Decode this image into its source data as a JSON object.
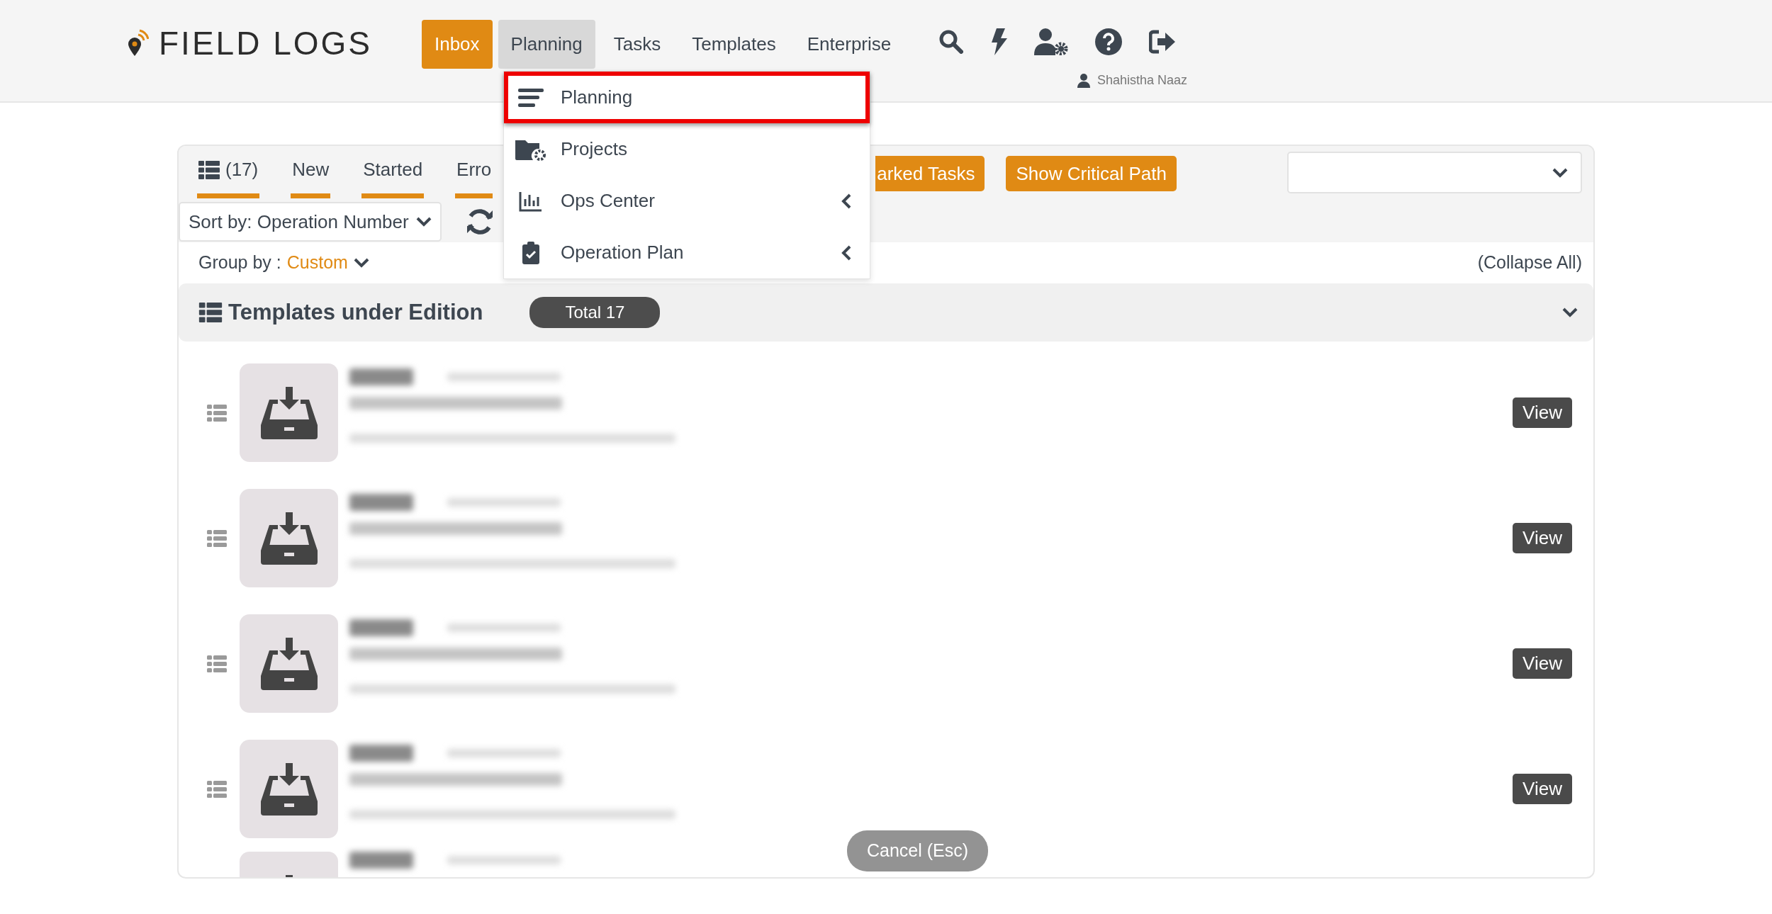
{
  "brand": {
    "name": "FIELD LOGS"
  },
  "nav": [
    {
      "label": "Inbox",
      "kind": "accent",
      "selected": false
    },
    {
      "label": "Planning",
      "kind": "link",
      "selected": true
    },
    {
      "label": "Tasks",
      "kind": "link",
      "selected": false
    },
    {
      "label": "Templates",
      "kind": "link",
      "selected": false
    },
    {
      "label": "Enterprise",
      "kind": "link",
      "selected": false
    }
  ],
  "user": {
    "name": "Shahistha Naaz"
  },
  "dropdown": {
    "items": [
      {
        "label": "Planning",
        "selected": true,
        "has_submenu": false
      },
      {
        "label": "Projects",
        "selected": false,
        "has_submenu": false
      },
      {
        "label": "Ops Center",
        "selected": false,
        "has_submenu": true
      },
      {
        "label": "Operation Plan",
        "selected": false,
        "has_submenu": true
      }
    ]
  },
  "tabs": [
    {
      "label": "(17)",
      "kind": "all"
    },
    {
      "label": "New",
      "kind": "status"
    },
    {
      "label": "Started",
      "kind": "status"
    },
    {
      "label": "Erro",
      "kind": "status"
    }
  ],
  "buttons": [
    "arked Tasks",
    "Show Critical Path"
  ],
  "sort": {
    "label": "Sort by: Operation Number"
  },
  "group_by": {
    "label": "Group by :",
    "value": "Custom"
  },
  "collapse_all": "(Collapse All)",
  "group": {
    "title": "Templates under Edition",
    "total": "Total 17",
    "expanded": true
  },
  "rows": [
    {
      "kind": "full",
      "action": "View"
    },
    {
      "kind": "full",
      "action": "View"
    },
    {
      "kind": "full",
      "action": "View"
    },
    {
      "kind": "full",
      "action": "View"
    },
    {
      "kind": "partial"
    }
  ],
  "cancel": "Cancel (Esc)"
}
